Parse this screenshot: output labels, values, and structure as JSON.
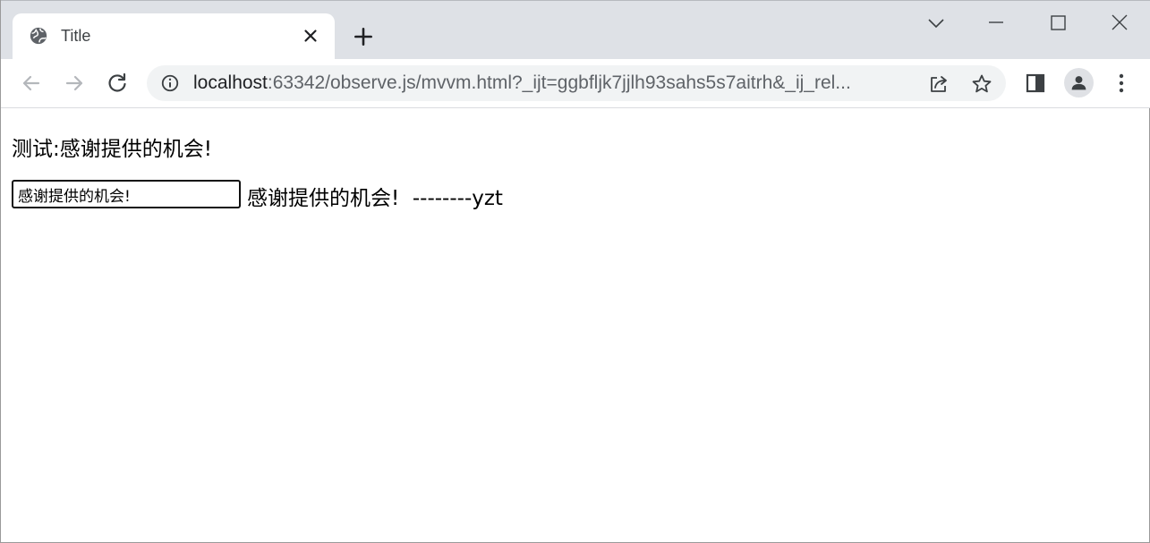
{
  "browser": {
    "tab": {
      "title": "Title",
      "favicon": "globe-icon"
    },
    "omnibox": {
      "host": "localhost",
      "path": ":63342/observe.js/mvvm.html?_ijt=ggbfljk7jjlh93sahs5s7aitrh&_ij_rel..."
    },
    "icons": {
      "back": "arrow-left-icon",
      "forward": "arrow-right-icon",
      "reload": "reload-icon",
      "info": "info-icon",
      "share": "share-icon",
      "bookmark": "star-icon",
      "sidepanel": "side-panel-icon",
      "profile": "person-icon",
      "menu": "kebab-menu-icon",
      "tab_search": "chevron-down-icon",
      "minimize": "minimize-icon",
      "maximize": "maximize-icon",
      "close": "close-icon"
    }
  },
  "page": {
    "heading": "测试:感谢提供的机会!",
    "input_value": "感谢提供的机会!",
    "mirror_text": "感谢提供的机会!  --------yzt"
  },
  "colors": {
    "tabstrip_bg": "#dee1e6",
    "omnibox_bg": "#f1f3f4",
    "icon": "#5f6368"
  }
}
